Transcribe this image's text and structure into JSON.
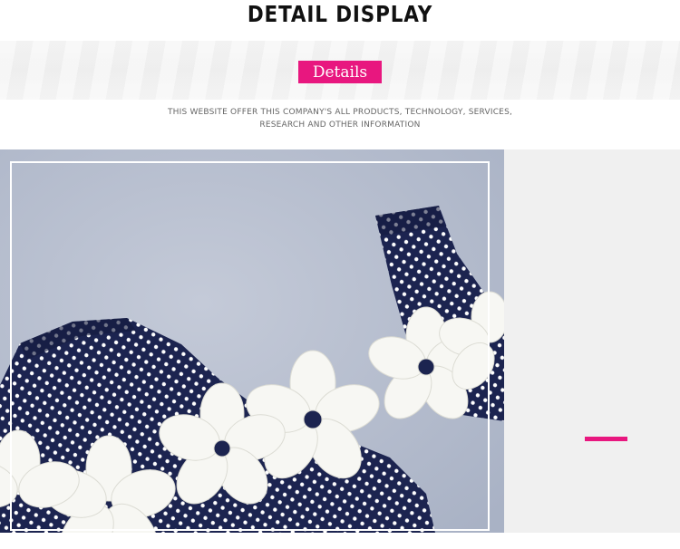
{
  "header": {
    "title": "DETAIL DISPLAY"
  },
  "banner": {
    "tag_label": "Details",
    "subtitle_line1": "THIS WEBSITE OFFER THIS COMPANY'S ALL PRODUCTS, TECHNOLOGY, SERVICES,",
    "subtitle_line2": "RESEARCH AND OTHER INFORMATION"
  },
  "colors": {
    "accent": "#e8177f",
    "navy_fabric": "#1c2450",
    "photo_background": "#b8c0d1",
    "side_panel": "#f0f0f0"
  },
  "photo": {
    "subject": "navy-polka-dot-strap-with-white-lace-flowers"
  }
}
